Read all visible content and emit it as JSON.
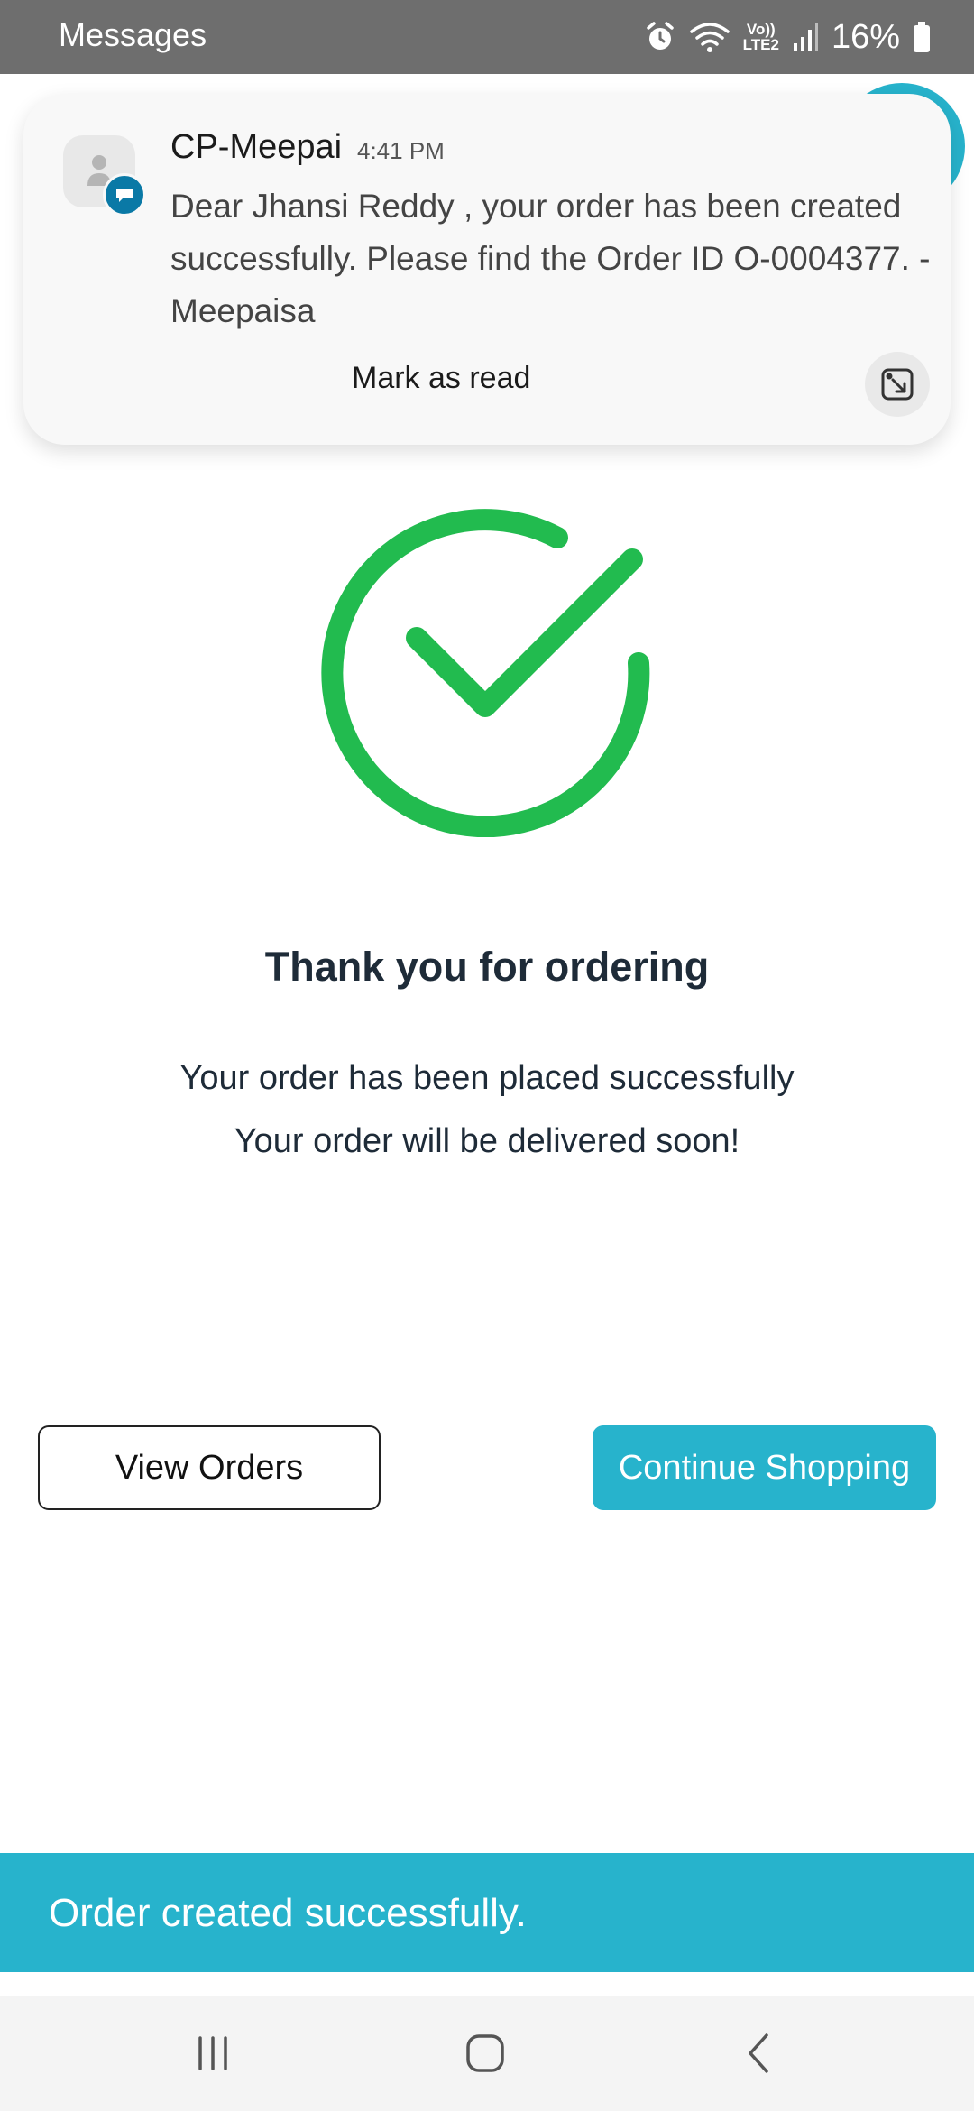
{
  "status_bar": {
    "app_name": "Messages",
    "network_label_1": "Vo))",
    "network_label_2": "LTE2",
    "battery": "16%"
  },
  "notification": {
    "sender": "CP-Meepai",
    "time": "4:41 PM",
    "body": "Dear Jhansi Reddy , your order has been created successfully. Please find the Order ID O-0004377. - Meepaisa",
    "action_label": "Mark as read"
  },
  "main": {
    "title": "Thank you for ordering",
    "message_line_1": "Your order has been placed successfully",
    "message_line_2": "Your order will be delivered soon!"
  },
  "buttons": {
    "view_orders": "View Orders",
    "continue_shopping": "Continue Shopping"
  },
  "toast": {
    "message": "Order created successfully."
  },
  "icons": {
    "status": [
      "alarm-icon",
      "wifi-icon",
      "signal-icon",
      "battery-icon"
    ],
    "notification": [
      "contact-avatar-icon",
      "message-badge-icon",
      "expand-icon"
    ],
    "main": "success-check-icon",
    "nav": [
      "recents-icon",
      "home-icon",
      "back-icon"
    ]
  },
  "colors": {
    "accent": "#27b3cc",
    "success_green": "#22bb4f",
    "status_bar": "#6e6e6e",
    "text_dark": "#1e2b38"
  }
}
